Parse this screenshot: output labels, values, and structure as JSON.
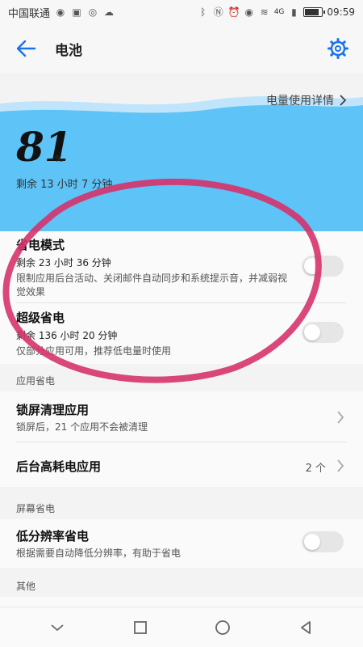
{
  "status_bar": {
    "carrier": "中国联通",
    "network": "4G",
    "time": "09:59",
    "battery_level_fraction": 0.81
  },
  "header": {
    "title": "电池"
  },
  "hero": {
    "detail_link": "电量使用详情",
    "percent": "81",
    "percent_sign": "%",
    "remaining": "剩余 13 小时 7 分钟"
  },
  "power_modes": {
    "power_saving": {
      "title": "省电模式",
      "remaining": "剩余 23 小时 36 分钟",
      "description": "限制应用后台活动、关闭邮件自动同步和系统提示音，并减弱视觉效果",
      "enabled": false
    },
    "ultra_saving": {
      "title": "超级省电",
      "remaining": "剩余 136 小时 20 分钟",
      "description": "仅部分应用可用，推荐低电量时使用",
      "enabled": false
    }
  },
  "app_saving": {
    "section_label": "应用省电",
    "lock_screen_clean": {
      "title": "锁屏清理应用",
      "description": "锁屏后，21 个应用不会被清理"
    },
    "background_high_power": {
      "title": "后台高耗电应用",
      "value": "2 个"
    }
  },
  "screen_saving": {
    "section_label": "屏幕省电",
    "low_resolution": {
      "title": "低分辨率省电",
      "description": "根据需要自动降低分辨率，有助于省电",
      "enabled": false
    }
  },
  "other": {
    "section_label": "其他"
  },
  "colors": {
    "accent": "#1a73e8",
    "wave_light": "#bfe4fb",
    "wave_main": "#5ec3f7",
    "annotation": "#d6336c"
  }
}
